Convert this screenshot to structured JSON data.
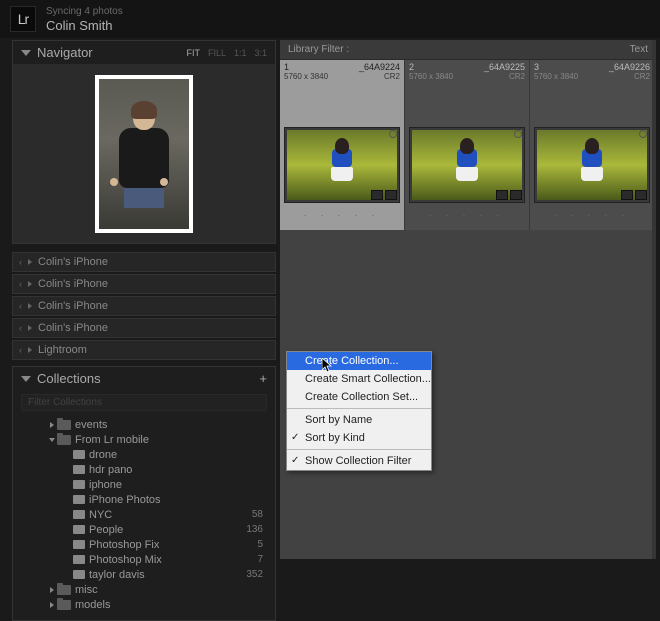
{
  "header": {
    "logo_text": "Lr",
    "sync_status": "Syncing 4 photos",
    "username": "Colin Smith"
  },
  "navigator": {
    "title": "Navigator",
    "fit": "FIT",
    "fill": "FILL",
    "one": "1:1",
    "ratio": "3:1"
  },
  "folders": {
    "items": [
      "Colin's iPhone",
      "Colin's iPhone",
      "Colin's iPhone",
      "Colin's iPhone",
      "Lightroom"
    ]
  },
  "collections": {
    "title": "Collections",
    "plus": "+",
    "search_placeholder": "Filter Collections"
  },
  "tree": [
    {
      "depth": 1,
      "arrow": "right",
      "type": "folder",
      "label": "events",
      "count": ""
    },
    {
      "depth": 1,
      "arrow": "down",
      "type": "folder",
      "label": "From Lr mobile",
      "count": ""
    },
    {
      "depth": 2,
      "arrow": "",
      "type": "coll",
      "label": "drone",
      "count": ""
    },
    {
      "depth": 2,
      "arrow": "",
      "type": "coll",
      "label": "hdr pano",
      "count": ""
    },
    {
      "depth": 2,
      "arrow": "",
      "type": "coll",
      "label": "iphone",
      "count": ""
    },
    {
      "depth": 2,
      "arrow": "",
      "type": "coll",
      "label": "iPhone Photos",
      "count": ""
    },
    {
      "depth": 2,
      "arrow": "",
      "type": "coll",
      "label": "NYC",
      "count": "58"
    },
    {
      "depth": 2,
      "arrow": "",
      "type": "coll",
      "label": "People",
      "count": "136"
    },
    {
      "depth": 2,
      "arrow": "",
      "type": "coll",
      "label": "Photoshop Fix",
      "count": "5"
    },
    {
      "depth": 2,
      "arrow": "",
      "type": "coll",
      "label": "Photoshop Mix",
      "count": "7"
    },
    {
      "depth": 2,
      "arrow": "",
      "type": "coll",
      "label": "taylor davis",
      "count": "352"
    },
    {
      "depth": 1,
      "arrow": "right",
      "type": "folder",
      "label": "misc",
      "count": ""
    },
    {
      "depth": 1,
      "arrow": "right",
      "type": "folder",
      "label": "models",
      "count": ""
    }
  ],
  "filter_bar": {
    "label": "Library Filter :",
    "text_toggle": "Text"
  },
  "thumbs": [
    {
      "idx": "1",
      "name": "_64A9224",
      "dim": "5760 x 3840",
      "fmt": "CR2",
      "selected": true
    },
    {
      "idx": "2",
      "name": "_64A9225",
      "dim": "5760 x 3840",
      "fmt": "CR2",
      "selected": false
    },
    {
      "idx": "3",
      "name": "_64A9226",
      "dim": "5760 x 3840",
      "fmt": "CR2",
      "selected": false
    }
  ],
  "menu": {
    "create_collection": "Create Collection...",
    "create_smart": "Create Smart Collection...",
    "create_set": "Create Collection Set...",
    "sort_name": "Sort by Name",
    "sort_kind": "Sort by Kind",
    "show_filter": "Show Collection Filter"
  }
}
